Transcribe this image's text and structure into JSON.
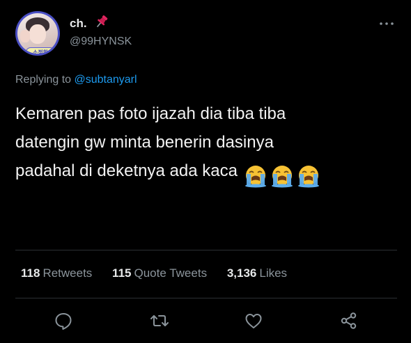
{
  "user": {
    "display_name": "ch.",
    "pin_emoji": "pushpin",
    "handle": "@99HYNSK",
    "avatar_badge": "소정환"
  },
  "reply": {
    "prefix": "Replying to",
    "mention": "@subtanyarl"
  },
  "tweet": {
    "lines": [
      "Kemaren pas foto ijazah dia tiba tiba",
      "datengin gw minta benerin dasinya",
      "padahal di deketnya ada kaca"
    ],
    "emojis": [
      "loudly-crying-face",
      "loudly-crying-face",
      "loudly-crying-face"
    ]
  },
  "stats": {
    "retweets_count": "118",
    "retweets_label": "Retweets",
    "quotes_count": "115",
    "quotes_label": "Quote Tweets",
    "likes_count": "3,136",
    "likes_label": "Likes"
  },
  "actions": [
    "reply-icon",
    "retweet-icon",
    "like-icon",
    "share-icon"
  ],
  "colors": {
    "background": "#000000",
    "text": "#e7e9ea",
    "muted": "#8b949b",
    "link": "#1d9bf0",
    "divider": "#2b2f33"
  }
}
